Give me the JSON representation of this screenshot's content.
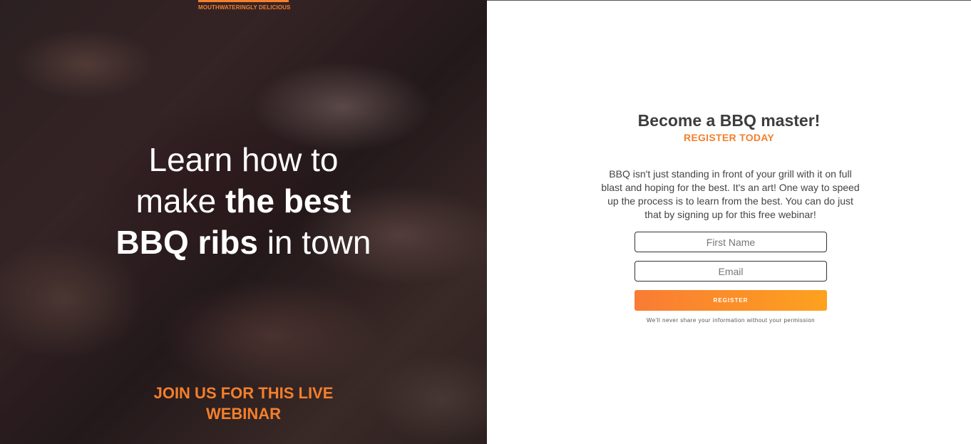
{
  "hero": {
    "tagline": "MOUTHWATERINGLY DELICIOUS",
    "headline": {
      "line1": "Learn how to",
      "line2_prefix": "make ",
      "line2_bold": "the best",
      "line3_bold": "BBQ ribs",
      "line3_suffix": " in town"
    },
    "cta": "JOIN US FOR THIS LIVE WEBINAR"
  },
  "form": {
    "title": "Become a BBQ master!",
    "subtitle": "REGISTER TODAY",
    "description": "BBQ isn't just standing in front of your grill with it on full blast and hoping for the best. It's an art! One way to speed up the process is to learn from the best. You can do just that by signing up for this free webinar!",
    "first_name_placeholder": "First Name",
    "email_placeholder": "Email",
    "register_label": "REGISTER",
    "privacy_note": "We'll never share your information without your permission"
  },
  "colors": {
    "accent": "#f47f2c",
    "button_gradient_start": "#f97c34",
    "button_gradient_end": "#fda21f",
    "title_text": "#3d3d3d"
  }
}
